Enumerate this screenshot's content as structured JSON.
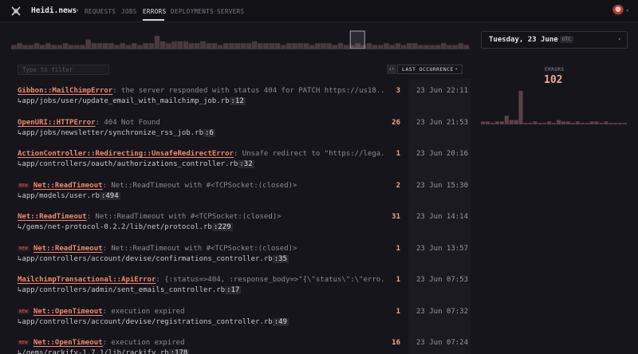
{
  "app": {
    "name": "Heidi.news"
  },
  "nav": {
    "tabs": [
      {
        "label": "REQUESTS",
        "active": false
      },
      {
        "label": "JOBS",
        "active": false
      },
      {
        "label": "ERRORS",
        "active": true
      },
      {
        "label": "DEPLOYMENTS",
        "active": false
      },
      {
        "label": "SERVERS",
        "active": false
      }
    ]
  },
  "colors": {
    "accent": "#f08870",
    "count": "#f0a58c",
    "background": "#16151b"
  },
  "icons": {
    "logo": "x-logo-icon",
    "caret": "chevron-down-icon",
    "return": "return-arrow-icon",
    "sort": "sort-direction-icon"
  },
  "histogram": {
    "values": [
      2,
      3,
      2,
      2,
      3,
      2,
      3,
      2,
      2,
      3,
      2,
      2,
      2,
      5,
      3,
      3,
      3,
      3,
      2,
      3,
      2,
      3,
      2,
      3,
      3,
      7,
      4,
      3,
      4,
      4,
      4,
      3,
      3,
      4,
      3,
      3,
      2,
      3,
      3,
      3,
      3,
      3,
      4,
      3,
      3,
      3,
      3,
      2,
      3,
      3,
      3,
      3,
      2,
      3,
      3,
      3,
      2,
      3,
      2,
      2,
      3,
      2,
      3,
      2,
      2,
      3,
      2,
      3,
      2,
      3,
      3,
      2,
      2,
      2,
      2,
      3,
      2,
      2,
      3,
      2
    ],
    "selected_index": 60
  },
  "date_picker": {
    "value": "Tuesday, 23 June",
    "timezone": "UTC"
  },
  "filter": {
    "placeholder": "Type to filter"
  },
  "sort": {
    "label": "LAST OCCURRENCE",
    "direction": "↓↑"
  },
  "errors": [
    {
      "new": false,
      "class": "Gibbon::MailChimpError",
      "message": ": the server responded with status 404 for PATCH https://us18...",
      "path": "app/jobs/user/update_email_with_mailchimp_job.rb",
      "line": ":12",
      "count": "3",
      "last": "23 Jun 22:11"
    },
    {
      "new": false,
      "class": "OpenURI::HTTPError",
      "message": ": 404 Not Found",
      "path": "app/jobs/newsletter/synchronize_rss_job.rb",
      "line": ":6",
      "count": "26",
      "last": "23 Jun 21:53"
    },
    {
      "new": false,
      "class": "ActionController::Redirecting::UnsafeRedirectError",
      "message": ": Unsafe redirect to \"https://lega...",
      "path": "app/controllers/oauth/authorizations_controller.rb",
      "line": ":32",
      "count": "1",
      "last": "23 Jun 20:16"
    },
    {
      "new": true,
      "class": "Net::ReadTimeout",
      "message": ": Net::ReadTimeout with #<TCPSocket:(closed)>",
      "path": "app/models/user.rb",
      "line": ":494",
      "count": "2",
      "last": "23 Jun 15:30"
    },
    {
      "new": false,
      "class": "Net::ReadTimeout",
      "message": ": Net::ReadTimeout with #<TCPSocket:(closed)>",
      "path": "/gems/net-protocol-0.2.2/lib/net/protocol.rb",
      "line": ":229",
      "count": "31",
      "last": "23 Jun 14:14"
    },
    {
      "new": true,
      "class": "Net::ReadTimeout",
      "message": ": Net::ReadTimeout with #<TCPSocket:(closed)>",
      "path": "app/controllers/account/devise/confirmations_controller.rb",
      "line": ":35",
      "count": "1",
      "last": "23 Jun 13:57"
    },
    {
      "new": false,
      "class": "MailchimpTransactional::ApiError",
      "message": ": {:status=>404, :response_body=>\"{\\\"status\\\":\\\"erro...",
      "path": "app/controllers/admin/sent_emails_controller.rb",
      "line": ":17",
      "count": "1",
      "last": "23 Jun 07:53"
    },
    {
      "new": true,
      "class": "Net::OpenTimeout",
      "message": ": execution expired",
      "path": "app/controllers/account/devise/registrations_controller.rb",
      "line": ":49",
      "count": "1",
      "last": "23 Jun 07:32"
    },
    {
      "new": true,
      "class": "Net::OpenTimeout",
      "message": ": execution expired",
      "path": "/gems/rackify-1.7.1/lib/rackify.rb",
      "line": ":178",
      "count": "16",
      "last": "23 Jun 07:24"
    }
  ],
  "summary": {
    "label": "ERRORS",
    "value": "102",
    "series": [
      2,
      2,
      1,
      2,
      2,
      6,
      3,
      3,
      23,
      1,
      1,
      2,
      1,
      1,
      2,
      1,
      3,
      2,
      2,
      1,
      2,
      1,
      1,
      2,
      2,
      1,
      2,
      1,
      1,
      1,
      1
    ]
  }
}
